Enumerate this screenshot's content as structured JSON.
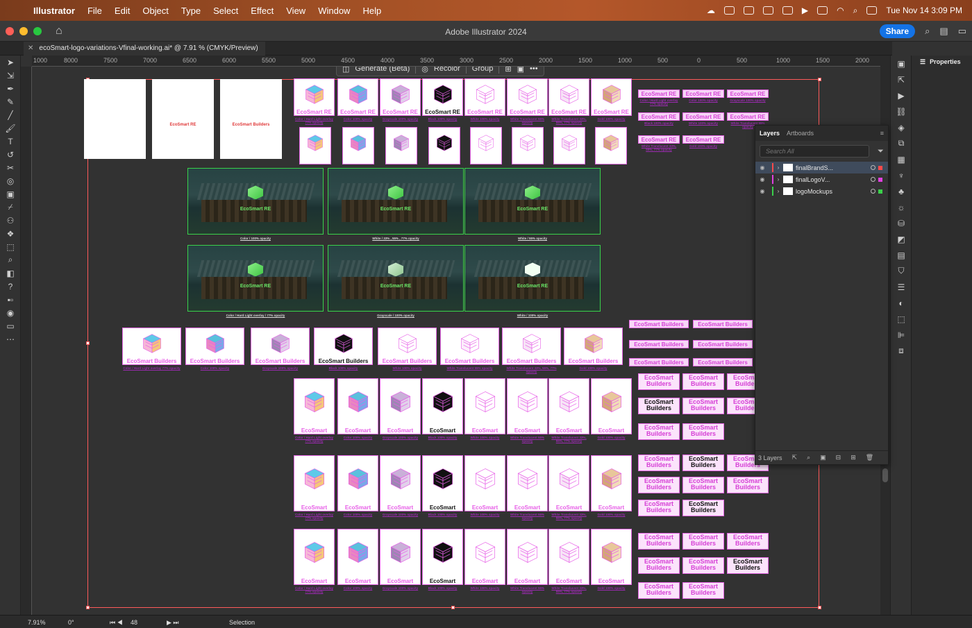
{
  "menubar": {
    "app_name": "Illustrator",
    "items": [
      "File",
      "Edit",
      "Object",
      "Type",
      "Select",
      "Effect",
      "View",
      "Window",
      "Help"
    ],
    "clock": "Tue Nov 14  3:09 PM"
  },
  "window": {
    "title": "Adobe Illustrator 2024",
    "share_label": "Share",
    "doc_tab": "ecoSmart-logo-variations-Vfinal-working.ai* @ 7.91 % (CMYK/Preview)"
  },
  "ruler_labels": [
    "1000",
    "8000",
    "7500",
    "7000",
    "6500",
    "6000",
    "5500",
    "5000",
    "4500",
    "4000",
    "3500",
    "3000",
    "2500",
    "2000",
    "1500",
    "1000",
    "500",
    "0",
    "500",
    "1000",
    "1500",
    "2000"
  ],
  "context_bar": {
    "generate": "Generate (Beta)",
    "recolor": "Recolor",
    "group": "Group"
  },
  "artwork": {
    "brand_re": "EcoSmart RE",
    "brand_builders": "EcoSmart Builders",
    "brand_builders_stacked": "EcoSmart Builders",
    "variants": [
      "Color / Hard Light overlay 77% opacity",
      "Color 100% opacity",
      "Grayscale 100% opacity",
      "Black 100% opacity",
      "White 100% opacity",
      "White Translucent 55% opacity",
      "White Translucent 33%, 55%, 77% opacity",
      "Gold 100% opacity"
    ],
    "mockup_captions": [
      "Color / 100% opacity",
      "White / 33% , 55% , 77% opacity",
      "White / 55% opacity",
      "Color / Hard Light overlay / 77% opacity",
      "Grayscale / 100% opacity",
      "White / 100% opacity"
    ]
  },
  "layers_panel": {
    "tab_layers": "Layers",
    "tab_artboards": "Artboards",
    "search_placeholder": "Search All",
    "layers": [
      {
        "name": "finalBrandS...",
        "color": "#ff4a4a"
      },
      {
        "name": "finalLogoV...",
        "color": "#e040e0"
      },
      {
        "name": "logoMockups",
        "color": "#3ad04a"
      }
    ],
    "count": "3 Layers"
  },
  "properties_label": "Properties",
  "status": {
    "zoom": "7.91%",
    "rotation": "0°",
    "artboard": "48",
    "tool": "Selection"
  },
  "colors": {
    "accent": "#1473e6",
    "artboard_outline": "#ff5a5a",
    "logo_pink": "#e75fe7"
  }
}
